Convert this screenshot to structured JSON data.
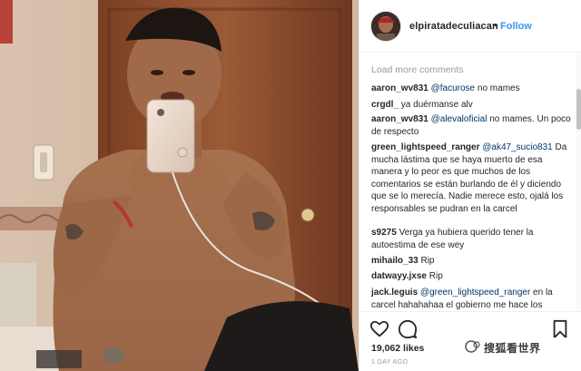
{
  "post": {
    "username": "elpiratadeculiacan",
    "separator": "•",
    "follow_label": "Follow"
  },
  "comments_section": {
    "load_more": "Load more comments",
    "items": [
      {
        "user": "aaron_wv831",
        "mention": "@facurose",
        "text": " no mames"
      },
      {
        "user": "crgdl_",
        "mention": "",
        "text": "ya duérmanse alv"
      },
      {
        "user": "aaron_wv831",
        "mention": "@alevaloficial",
        "text": " no mames. Un poco de respecto"
      },
      {
        "user": "green_lightspeed_ranger",
        "mention": "@ak47_sucio831",
        "text": " Da mucha lástima que se haya muerto de esa manera y lo peor es que muchos de los comentarios se están burlando de él y diciendo que se lo merecía. Nadie merece esto, ojalá los responsables se pudran en la carcel"
      },
      {
        "user": "s9275",
        "mention": "",
        "text": "Verga ya hubiera querido tener la autoestima de ese wey"
      },
      {
        "user": "mihailo_33",
        "mention": "",
        "text": "Rip"
      },
      {
        "user": "datwayy.jxse",
        "mention": "",
        "text": "Rip"
      },
      {
        "user": "jack.leguis",
        "mention": "@green_lightspeed_ranger",
        "text": " en la carcel hahahahaa el gobierno me hace los"
      }
    ]
  },
  "actions": {
    "like_icon": "heart-icon",
    "comment_icon": "comment-bubble-icon",
    "save_icon": "bookmark-icon"
  },
  "likes": "19,062 likes",
  "timestamp": "1 DAY AGO",
  "watermark": "搜狐看世界",
  "colors": {
    "link_blue": "#3897f0",
    "mention_blue": "#003569",
    "text": "#262626",
    "muted": "#999999",
    "border": "#efefef"
  }
}
